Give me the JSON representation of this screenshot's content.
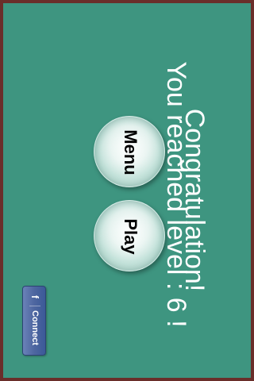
{
  "message": {
    "line1": "Congratulation!",
    "line2": "You reached level : 6 !"
  },
  "buttons": {
    "menu_label": "Menu",
    "play_label": "Play"
  },
  "facebook": {
    "icon_glyph": "f",
    "label": "Connect"
  },
  "colors": {
    "background": "#3e9580",
    "border": "#6a2e2a",
    "text": "#ffffff",
    "facebook": "#3b5998"
  }
}
